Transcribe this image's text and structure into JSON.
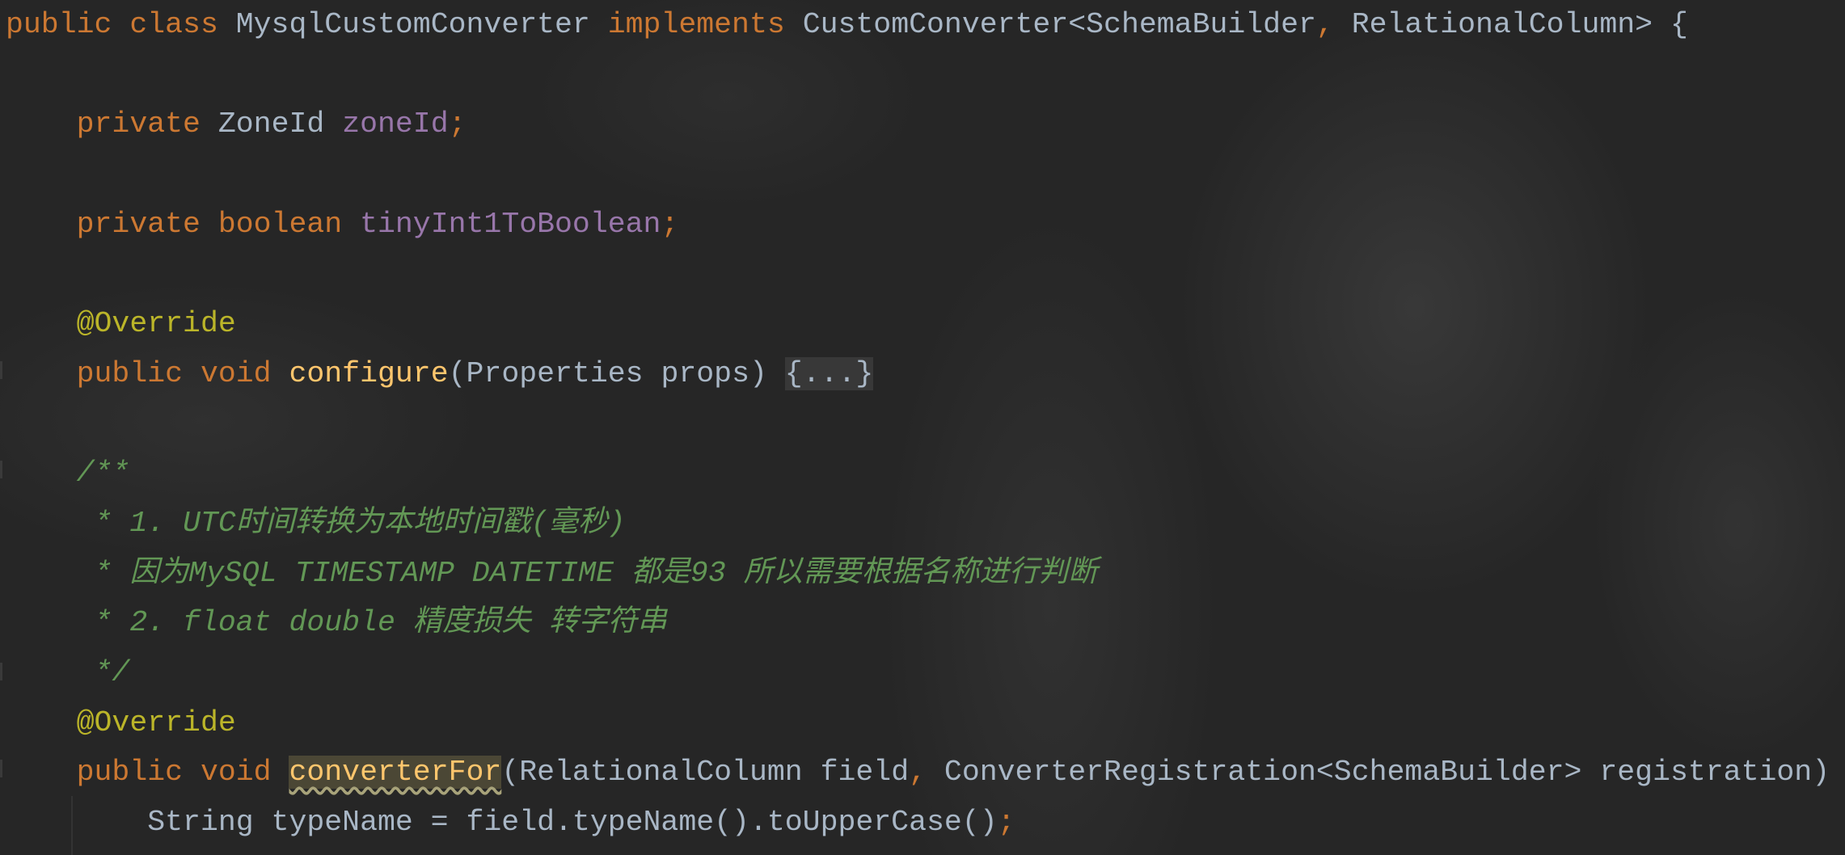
{
  "editor": {
    "colors": {
      "background": "#262626",
      "keyword": "#cc7832",
      "text": "#a9b7c6",
      "field": "#9876aa",
      "annotation": "#bbb529",
      "method": "#ffc66d",
      "comment": "#629755"
    },
    "lines": [
      {
        "tokens": [
          {
            "t": "kw",
            "text": "public class "
          },
          {
            "t": "plain",
            "text": "MysqlCustomConverter "
          },
          {
            "t": "kw",
            "text": "implements "
          },
          {
            "t": "plain",
            "text": "CustomConverter<SchemaBuilder"
          },
          {
            "t": "kw",
            "text": ", "
          },
          {
            "t": "plain",
            "text": "RelationalColumn> {"
          }
        ]
      },
      {
        "tokens": []
      },
      {
        "tokens": [
          {
            "t": "plain",
            "text": "    "
          },
          {
            "t": "kw",
            "text": "private "
          },
          {
            "t": "plain",
            "text": "ZoneId "
          },
          {
            "t": "field",
            "text": "zoneId"
          },
          {
            "t": "kw",
            "text": ";"
          }
        ]
      },
      {
        "tokens": []
      },
      {
        "tokens": [
          {
            "t": "plain",
            "text": "    "
          },
          {
            "t": "kw",
            "text": "private boolean "
          },
          {
            "t": "field",
            "text": "tinyInt1ToBoolean"
          },
          {
            "t": "kw",
            "text": ";"
          }
        ]
      },
      {
        "tokens": []
      },
      {
        "tokens": [
          {
            "t": "plain",
            "text": "    "
          },
          {
            "t": "ann",
            "text": "@Override"
          }
        ]
      },
      {
        "tokens": [
          {
            "t": "plain",
            "text": "    "
          },
          {
            "t": "kw",
            "text": "public void "
          },
          {
            "t": "method",
            "text": "configure"
          },
          {
            "t": "plain",
            "text": "(Properties props) "
          },
          {
            "t": "fold",
            "text": "{...}"
          }
        ]
      },
      {
        "tokens": []
      },
      {
        "tokens": [
          {
            "t": "plain",
            "text": "    "
          },
          {
            "t": "comment",
            "text": "/**"
          }
        ]
      },
      {
        "tokens": [
          {
            "t": "plain",
            "text": "    "
          },
          {
            "t": "comment",
            "text": " * 1. UTC时间转换为本地时间戳(毫秒)"
          }
        ]
      },
      {
        "tokens": [
          {
            "t": "plain",
            "text": "    "
          },
          {
            "t": "comment",
            "text": " * 因为MySQL TIMESTAMP DATETIME 都是93 所以需要根据名称进行判断"
          }
        ]
      },
      {
        "tokens": [
          {
            "t": "plain",
            "text": "    "
          },
          {
            "t": "comment",
            "text": " * 2. float double 精度损失 转字符串"
          }
        ]
      },
      {
        "tokens": [
          {
            "t": "plain",
            "text": "    "
          },
          {
            "t": "comment",
            "text": " */"
          }
        ]
      },
      {
        "tokens": [
          {
            "t": "plain",
            "text": "    "
          },
          {
            "t": "ann",
            "text": "@Override"
          }
        ]
      },
      {
        "tokens": [
          {
            "t": "plain",
            "text": "    "
          },
          {
            "t": "kw",
            "text": "public void "
          },
          {
            "t": "method highlight",
            "text": "converterFor"
          },
          {
            "t": "plain",
            "text": "(RelationalColumn field"
          },
          {
            "t": "kw",
            "text": ", "
          },
          {
            "t": "plain",
            "text": "ConverterRegistration<SchemaBuilder> registration)"
          }
        ]
      },
      {
        "tokens": [
          {
            "t": "plain",
            "text": "        String typeName = field.typeName().toUpperCase()"
          },
          {
            "t": "kw",
            "text": ";"
          }
        ]
      }
    ]
  }
}
